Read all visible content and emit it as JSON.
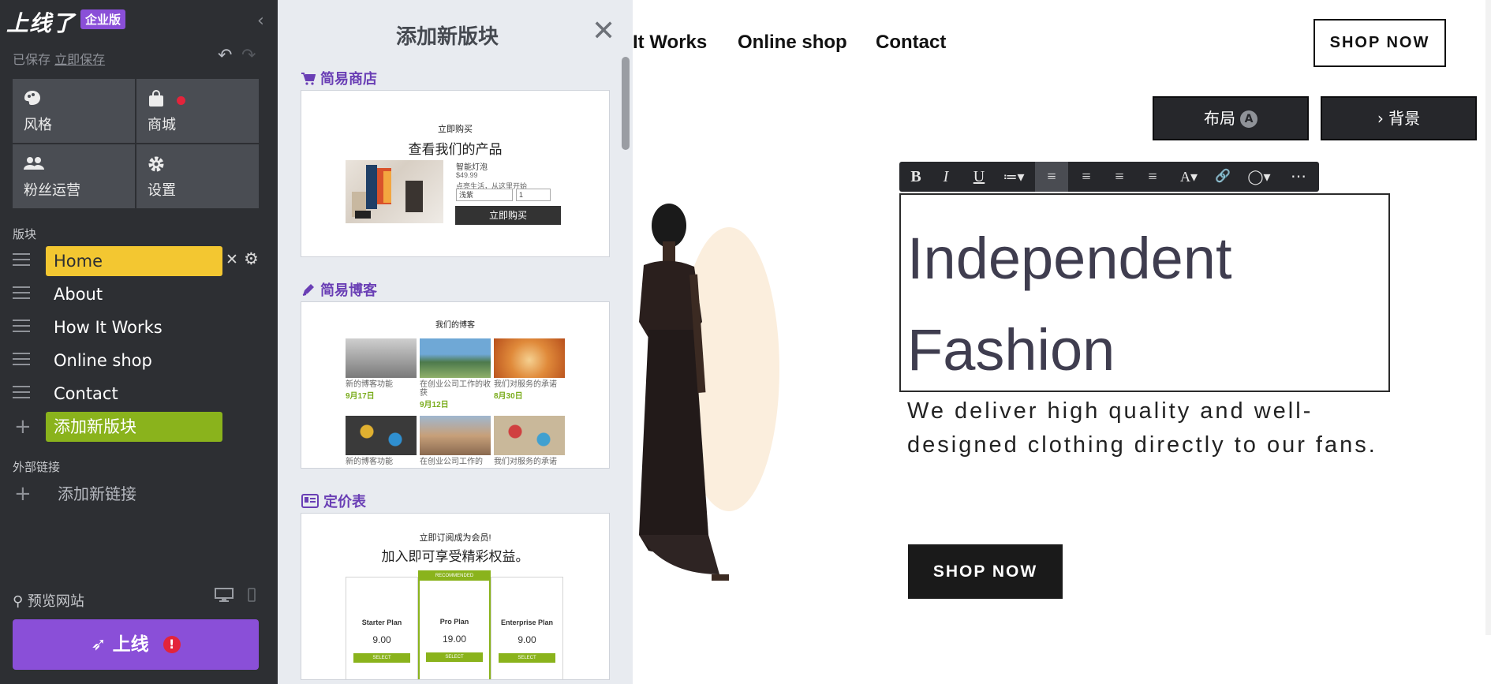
{
  "sidebar": {
    "logo": "上线了",
    "edition": "企业版",
    "collapse_icon": "chevron-left-icon",
    "saved_text": "已保存",
    "save_now": "立即保存",
    "tiles": [
      {
        "label": "风格",
        "icon": "palette-icon"
      },
      {
        "label": "商城",
        "icon": "shopping-bag-icon"
      },
      {
        "label": "粉丝运营",
        "icon": "users-icon"
      },
      {
        "label": "设置",
        "icon": "gear-icon"
      }
    ],
    "section_blocks": "版块",
    "pages": [
      "Home",
      "About",
      "How It Works",
      "Online shop",
      "Contact"
    ],
    "add_block": "添加新版块",
    "section_links": "外部链接",
    "add_link": "添加新链接",
    "preview": "预览网站",
    "publish": "上线",
    "publish_warning": "!"
  },
  "panel": {
    "title": "添加新版块",
    "categories": [
      {
        "label": "简易商店",
        "icon": "cart-icon"
      },
      {
        "label": "简易博客",
        "icon": "pen-icon"
      },
      {
        "label": "定价表",
        "icon": "pricing-icon"
      }
    ],
    "shop_card": {
      "small": "立即购买",
      "big": "查看我们的产品",
      "product": "智能灯泡",
      "price": "$49.99",
      "desc": "点亮生活，从这里开始",
      "variant": "浅紫",
      "qty": "1",
      "button": "立即购买"
    },
    "blog_card": {
      "title": "我们的博客",
      "posts": [
        {
          "caption": "新的博客功能",
          "date": "9月17日"
        },
        {
          "caption": "在创业公司工作的收获",
          "date": "9月12日"
        },
        {
          "caption": "我们对服务的承诺",
          "date": "8月30日"
        },
        {
          "caption": "新的博客功能",
          "date": ""
        },
        {
          "caption": "在创业公司工作的",
          "date": ""
        },
        {
          "caption": "我们对服务的承诺",
          "date": ""
        }
      ]
    },
    "pricing_card": {
      "small": "立即订阅成为会员!",
      "big": "加入即可享受精彩权益。",
      "recommended": "RECOMMENDED",
      "select": "SELECT",
      "plans": [
        {
          "name": "Starter Plan",
          "price": "9.00"
        },
        {
          "name": "Pro Plan",
          "price": "19.00"
        },
        {
          "name": "Enterprise Plan",
          "price": "9.00"
        }
      ]
    }
  },
  "site": {
    "nav": [
      "It Works",
      "Online shop",
      "Contact"
    ],
    "nav_shop": "SHOP NOW",
    "layout_btn": "布局",
    "layout_badge": "A",
    "bg_btn": "› 背景",
    "toolbar": [
      "B",
      "I",
      "U",
      "≔▾",
      "≡",
      "≡",
      "≡",
      "≡",
      "A▾",
      "🔗",
      "◯▾",
      "⋯"
    ],
    "hero_title": "Independent Fashion",
    "hero_sub": "We deliver high quality and well-designed clothing directly to our fans.",
    "cta": "SHOP NOW"
  },
  "colors": {
    "sidebar_bg": "#2d2f33",
    "accent_purple": "#8a4fd8",
    "home_yellow": "#f3c731",
    "add_green": "#8ab31c",
    "panel_bg": "#e8ebf0"
  }
}
